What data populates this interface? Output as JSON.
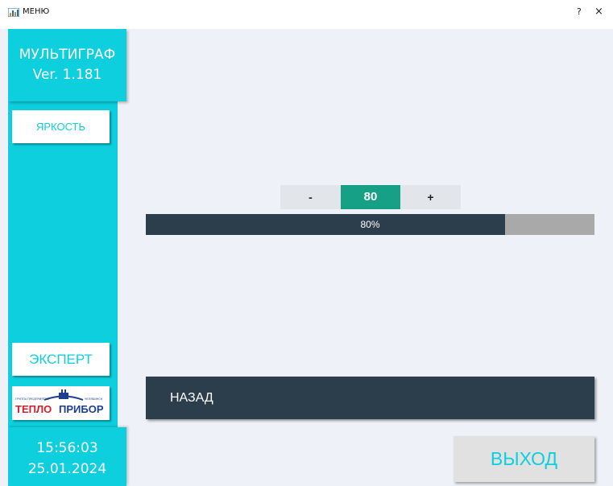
{
  "window": {
    "title": "МЕНЮ",
    "help_label": "?",
    "close_label": "×",
    "icon": "chart-app-icon"
  },
  "sidebar": {
    "app_name": "МУЛЬТИГРАФ",
    "version": "Ver. 1.181",
    "brightness_button": "ЯРКОСТЬ",
    "expert_button": "ЭКСПЕРТ",
    "logo": {
      "brand_prefix": "ТЕПЛО",
      "brand_suffix": "ПРИБОР",
      "tagline_left": "ГРУППА ПРЕДПРИЯТИЙ",
      "tagline_right": "ЧЕЛЯБИНСК"
    },
    "clock_time": "15:56:03",
    "clock_date": "25.01.2024"
  },
  "brightness": {
    "minus_label": "-",
    "value": "80",
    "plus_label": "+",
    "percent": 80,
    "percent_text": "80%"
  },
  "buttons": {
    "back": "НАЗАД",
    "exit": "ВЫХОД"
  },
  "colors": {
    "accent": "#0dcfde",
    "dark": "#2c3e4c",
    "value_green": "#16a085",
    "track_gray": "#a9a9a9",
    "background": "#eef2f8",
    "logo_red": "#d0202e",
    "logo_blue": "#1e3f8f"
  }
}
